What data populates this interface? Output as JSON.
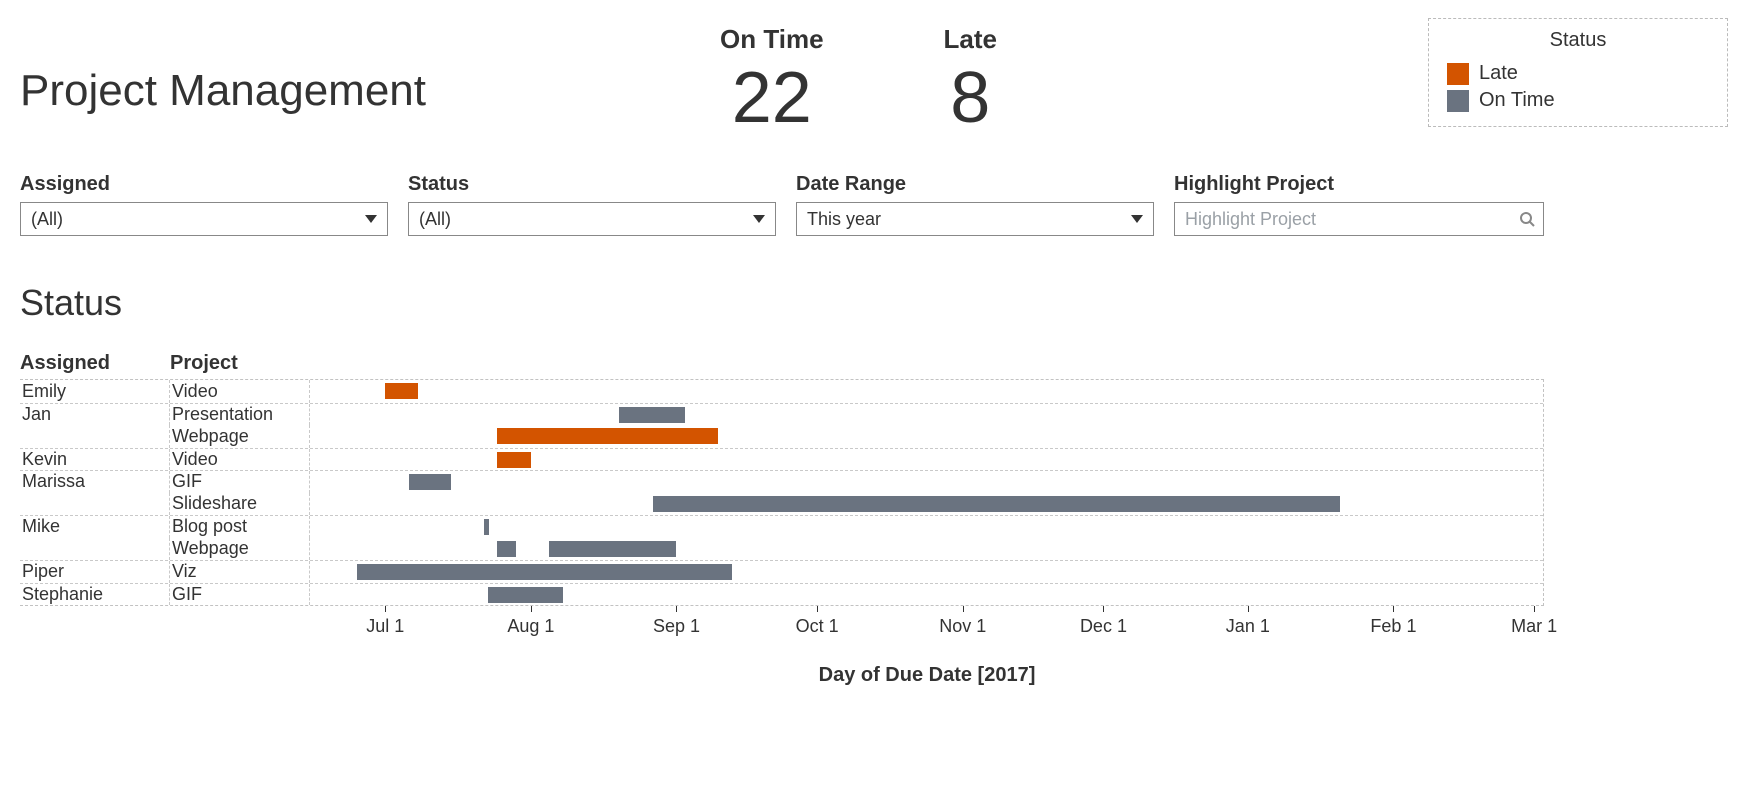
{
  "title": "Project Management",
  "kpis": {
    "ontime": {
      "label": "On Time",
      "value": "22"
    },
    "late": {
      "label": "Late",
      "value": "8"
    }
  },
  "legend": {
    "title": "Status",
    "items": [
      {
        "label": "Late",
        "color": "#d35400"
      },
      {
        "label": "On Time",
        "color": "#6a7380"
      }
    ]
  },
  "filters": {
    "assigned": {
      "label": "Assigned",
      "value": "(All)"
    },
    "status": {
      "label": "Status",
      "value": "(All)"
    },
    "date": {
      "label": "Date Range",
      "value": "This year"
    },
    "highlight": {
      "label": "Highlight Project",
      "placeholder": "Highlight Project"
    }
  },
  "section_title": "Status",
  "columns": {
    "assigned": "Assigned",
    "project": "Project"
  },
  "chart_data": {
    "type": "bar",
    "title": "Status",
    "xlabel": "Day of Due Date [2017]",
    "x_ticks": [
      "Jul 1",
      "Aug 1",
      "Sep 1",
      "Oct 1",
      "Nov 1",
      "Dec 1",
      "Jan 1",
      "Feb 1",
      "Mar 1"
    ],
    "x_range": [
      "2017-06-15",
      "2018-03-04"
    ],
    "rows": [
      {
        "assigned": "Emily",
        "project": "Video",
        "status": "Late",
        "start": "2017-07-01",
        "end": "2017-07-08"
      },
      {
        "assigned": "Jan",
        "project": "Presentation",
        "status": "On Time",
        "start": "2017-08-20",
        "end": "2017-09-03"
      },
      {
        "assigned": "Jan",
        "project": "Webpage",
        "status": "Late",
        "start": "2017-07-25",
        "end": "2017-09-10"
      },
      {
        "assigned": "Kevin",
        "project": "Video",
        "status": "Late",
        "start": "2017-07-25",
        "end": "2017-08-01"
      },
      {
        "assigned": "Marissa",
        "project": "GIF",
        "status": "On Time",
        "start": "2017-07-06",
        "end": "2017-07-15"
      },
      {
        "assigned": "Marissa",
        "project": "Slideshare",
        "status": "On Time",
        "start": "2017-08-27",
        "end": "2018-01-20"
      },
      {
        "assigned": "Mike",
        "project": "Blog post",
        "status": "On Time",
        "start": "2017-07-22",
        "end": "2017-07-23"
      },
      {
        "assigned": "Mike",
        "project": "Webpage",
        "status": "On Time",
        "start": "2017-07-25",
        "end": "2017-07-29"
      },
      {
        "assigned": "Mike",
        "project": "Webpage",
        "status": "On Time",
        "start": "2017-08-05",
        "end": "2017-09-01"
      },
      {
        "assigned": "Piper",
        "project": "Viz",
        "status": "On Time",
        "start": "2017-06-25",
        "end": "2017-09-12"
      },
      {
        "assigned": "Stephanie",
        "project": "GIF",
        "status": "On Time",
        "start": "2017-07-23",
        "end": "2017-08-08"
      }
    ]
  },
  "gantt_rows": [
    {
      "assigned": "Emily",
      "project": "Video",
      "new_assignee": true,
      "bars": [
        {
          "status": "late",
          "left_pct": 6.1,
          "width_pct": 2.7
        }
      ]
    },
    {
      "assigned": "Jan",
      "project": "Presentation",
      "new_assignee": true,
      "bars": [
        {
          "status": "ontime",
          "left_pct": 25.1,
          "width_pct": 5.3
        }
      ]
    },
    {
      "assigned": "",
      "project": "Webpage",
      "new_assignee": false,
      "bars": [
        {
          "status": "late",
          "left_pct": 15.2,
          "width_pct": 17.9
        }
      ]
    },
    {
      "assigned": "Kevin",
      "project": "Video",
      "new_assignee": true,
      "bars": [
        {
          "status": "late",
          "left_pct": 15.2,
          "width_pct": 2.7
        }
      ]
    },
    {
      "assigned": "Marissa",
      "project": "GIF",
      "new_assignee": true,
      "bars": [
        {
          "status": "ontime",
          "left_pct": 8.0,
          "width_pct": 3.4
        }
      ]
    },
    {
      "assigned": "",
      "project": "Slideshare",
      "new_assignee": false,
      "bars": [
        {
          "status": "ontime",
          "left_pct": 27.8,
          "width_pct": 55.7
        }
      ]
    },
    {
      "assigned": "Mike",
      "project": "Blog post",
      "new_assignee": true,
      "bars": [
        {
          "status": "ontime",
          "left_pct": 14.1,
          "width_pct": 0.4
        }
      ]
    },
    {
      "assigned": "",
      "project": "Webpage",
      "new_assignee": false,
      "bars": [
        {
          "status": "ontime",
          "left_pct": 15.2,
          "width_pct": 1.5
        },
        {
          "status": "ontime",
          "left_pct": 19.4,
          "width_pct": 10.3
        }
      ]
    },
    {
      "assigned": "Piper",
      "project": "Viz",
      "new_assignee": true,
      "bars": [
        {
          "status": "ontime",
          "left_pct": 3.8,
          "width_pct": 30.4
        }
      ]
    },
    {
      "assigned": "Stephanie",
      "project": "GIF",
      "new_assignee": true,
      "bars": [
        {
          "status": "ontime",
          "left_pct": 14.4,
          "width_pct": 6.1
        }
      ]
    }
  ],
  "tick_positions_pct": [
    6.1,
    17.9,
    29.7,
    41.1,
    52.9,
    64.3,
    76.0,
    87.8,
    99.2
  ]
}
